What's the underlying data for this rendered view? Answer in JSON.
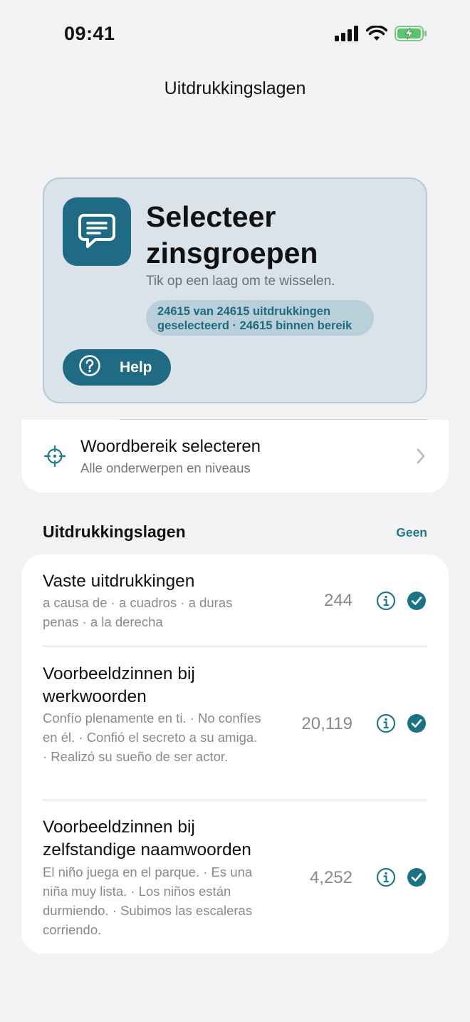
{
  "status_bar": {
    "time": "09:41"
  },
  "nav": {
    "title": "Uitdrukkingslagen"
  },
  "hero": {
    "icon": "chat-bubble-icon",
    "title": "Selecteer zinsgroepen",
    "subtitle": "Tik op een laag om te wisselen.",
    "badge_line1": "24615 van 24615 uitdrukkingen",
    "badge_line2": "geselecteerd · 24615 binnen bereik",
    "help_label": "Help"
  },
  "range": {
    "icon": "crosshair-icon",
    "title": "Woordbereik selecteren",
    "subtitle": "Alle onderwerpen en niveaus"
  },
  "section": {
    "title": "Uitdrukkingslagen",
    "action": "Geen"
  },
  "layers": [
    {
      "title": "Vaste uitdrukkingen",
      "examples": "a causa de · a cuadros · a duras penas · a la derecha",
      "count": "244",
      "selected": true
    },
    {
      "title": "Voorbeeldzinnen bij werkwoorden",
      "examples": "Confío plenamente en ti. · No confíes en él. · Confió el secreto a su amiga. · Realizó su sueño de ser actor.",
      "count": "20,119",
      "selected": true
    },
    {
      "title": "Voorbeeldzinnen bij zelfstandige naamwoorden",
      "examples": "El niño juega en el parque. · Es una niña muy lista. · Los niños están durmiendo. · Subimos las escaleras corriendo.",
      "count": "4,252",
      "selected": true
    }
  ],
  "colors": {
    "accent": "#1e6b83",
    "teal": "#1f7a8b",
    "hero_bg": "#dbe3ea"
  }
}
